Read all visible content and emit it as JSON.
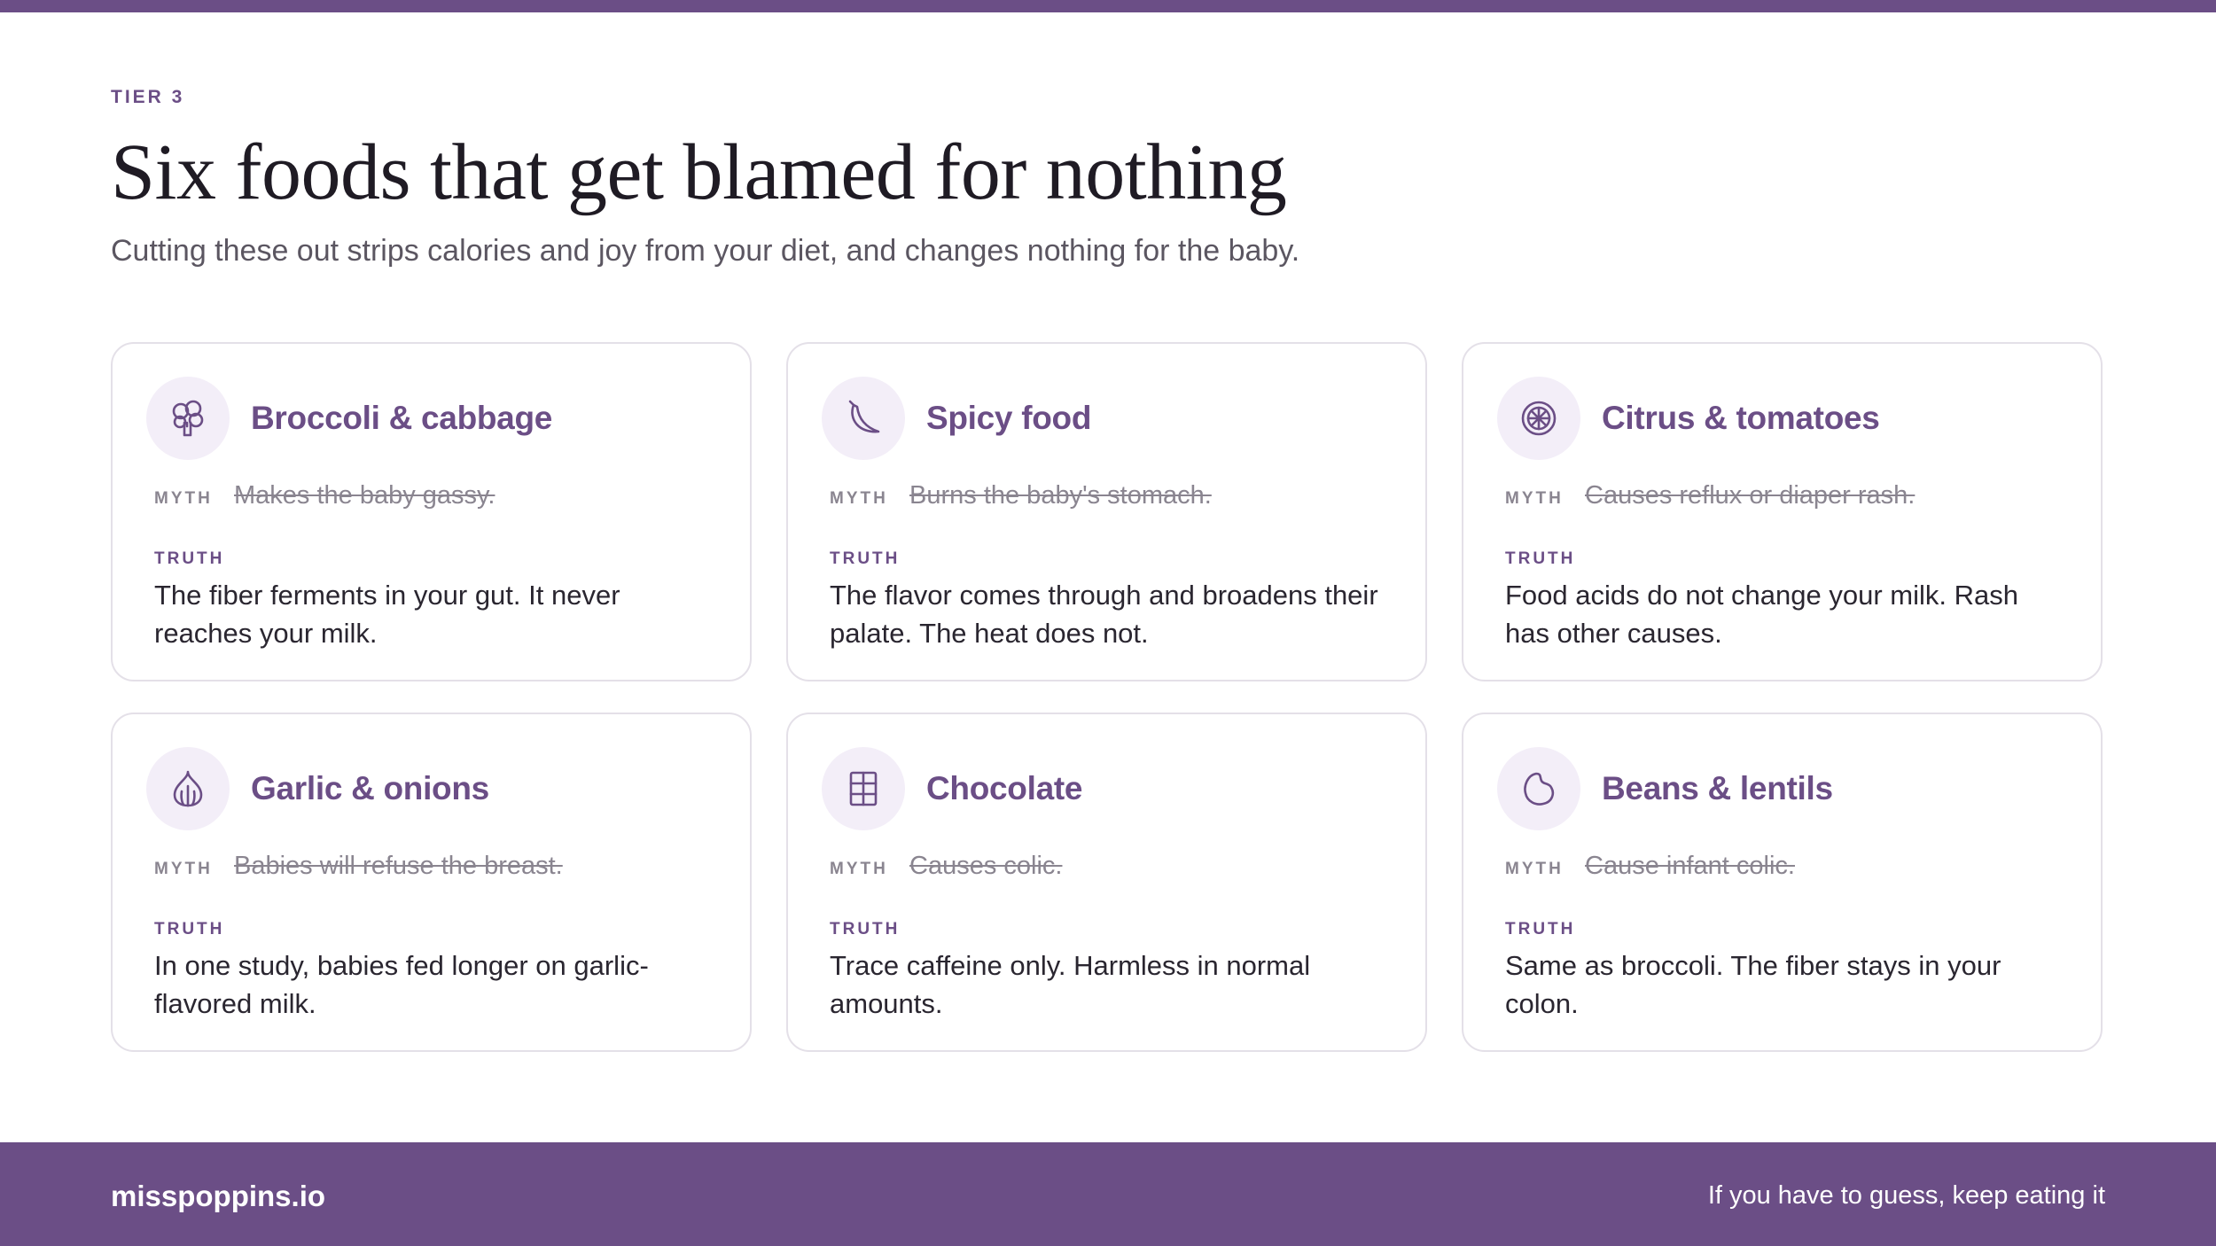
{
  "eyebrow": "TIER 3",
  "title": "Six foods that get blamed for nothing",
  "subtitle": "Cutting these out strips calories and joy from your diet, and changes nothing for the baby.",
  "labels": {
    "myth": "MYTH",
    "truth": "TRUTH"
  },
  "cards": [
    {
      "icon": "broccoli-icon",
      "title": "Broccoli & cabbage",
      "myth": "Makes the baby gassy.",
      "truth": "The fiber ferments in your gut. It never reaches your milk."
    },
    {
      "icon": "chili-pepper-icon",
      "title": "Spicy food",
      "myth": "Burns the baby's stomach.",
      "truth": "The flavor comes through and broadens their palate. The heat does not."
    },
    {
      "icon": "citrus-slice-icon",
      "title": "Citrus & tomatoes",
      "myth": "Causes reflux or diaper rash.",
      "truth": "Food acids do not change your milk. Rash has other causes."
    },
    {
      "icon": "garlic-icon",
      "title": "Garlic & onions",
      "myth": "Babies will refuse the breast.",
      "truth": "In one study, babies fed longer on garlic-flavored milk."
    },
    {
      "icon": "chocolate-bar-icon",
      "title": "Chocolate",
      "myth": "Causes colic.",
      "truth": "Trace caffeine only. Harmless in normal amounts."
    },
    {
      "icon": "bean-icon",
      "title": "Beans & lentils",
      "myth": "Cause infant colic.",
      "truth": "Same as broccoli. The fiber stays in your colon."
    }
  ],
  "footer": {
    "brand": "misspoppins.io",
    "tagline": "If you have to guess, keep eating it"
  },
  "colors": {
    "accent": "#6b4e86",
    "icon_bg": "#f3eef8",
    "card_border": "#e4e0e8"
  }
}
